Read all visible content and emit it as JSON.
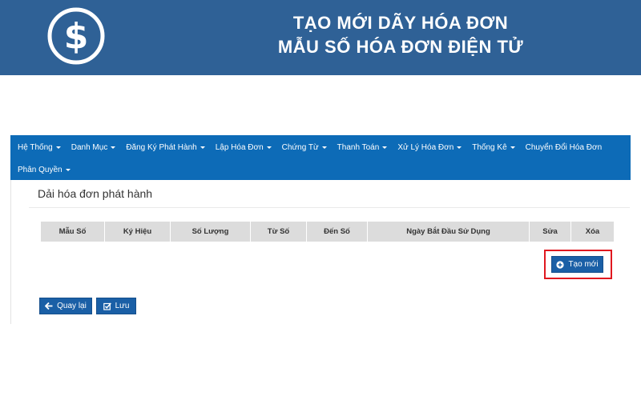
{
  "banner": {
    "title_line1": "TẠO MỚI DÃY HÓA ĐƠN",
    "title_line2": "MẪU SỐ HÓA ĐƠN ĐIỆN TỬ",
    "bg_color": "#2f6196"
  },
  "navbar": {
    "bg_color": "#0d6bb7",
    "items": [
      {
        "label": "Hệ Thống",
        "dropdown": true
      },
      {
        "label": "Danh Mục",
        "dropdown": true
      },
      {
        "label": "Đăng Ký Phát Hành",
        "dropdown": true
      },
      {
        "label": "Lập Hóa Đơn",
        "dropdown": true
      },
      {
        "label": "Chứng Từ",
        "dropdown": true
      },
      {
        "label": "Thanh Toán",
        "dropdown": true
      },
      {
        "label": "Xử Lý Hóa Đơn",
        "dropdown": true
      },
      {
        "label": "Thống Kê",
        "dropdown": true
      },
      {
        "label": "Chuyển Đổi Hóa Đơn",
        "dropdown": false
      },
      {
        "label": "Phân Quyền",
        "dropdown": true
      }
    ]
  },
  "panel": {
    "title": "Dải hóa đơn phát hành"
  },
  "table": {
    "columns": [
      "Mẫu Số",
      "Ký Hiệu",
      "Số Lượng",
      "Từ Số",
      "Đến Số",
      "Ngày Bắt Đầu Sử Dụng",
      "Sửa",
      "Xóa"
    ],
    "rows": []
  },
  "buttons": {
    "create": {
      "label": "Tạo mới",
      "icon": "plus-circle-icon"
    },
    "back": {
      "label": "Quay lại",
      "icon": "arrow-left-icon"
    },
    "save": {
      "label": "Lưu",
      "icon": "checkbox-icon"
    }
  },
  "colors": {
    "primary": "#0d6bb7",
    "button": "#1a5fa6",
    "highlight": "#e0181f",
    "header_bg": "#dcdcdc"
  }
}
